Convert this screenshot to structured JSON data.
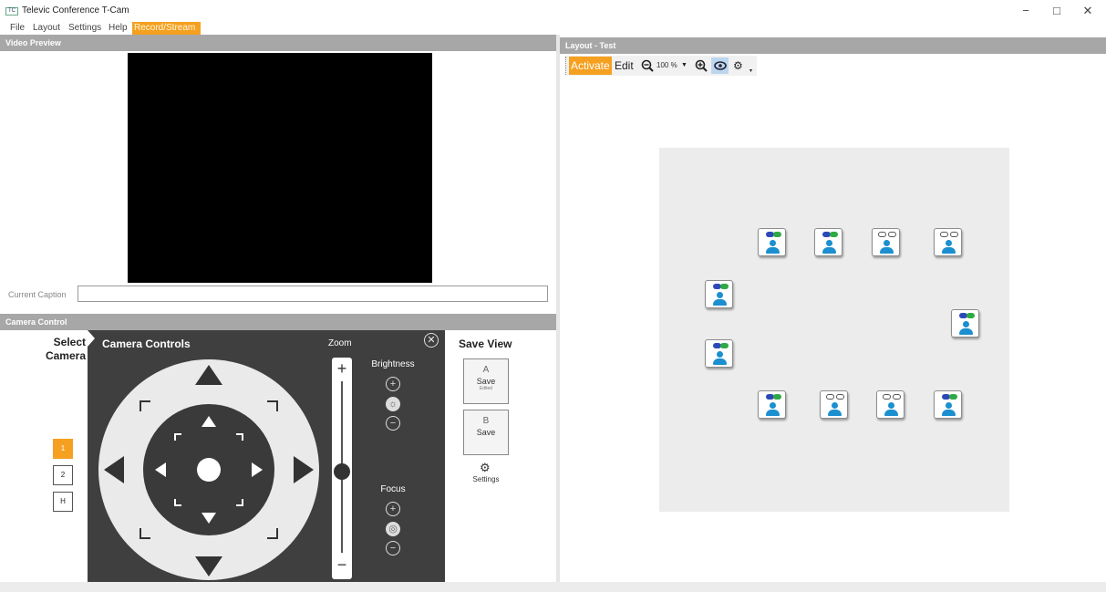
{
  "window": {
    "title": "Televic Conference T-Cam",
    "app_icon_text": "TC",
    "minimize": "−",
    "maximize": "□",
    "close": "✕"
  },
  "menu": {
    "items": [
      "File",
      "Layout",
      "Settings",
      "Help",
      "Record/Stream"
    ],
    "active": "Record/Stream"
  },
  "video_preview": {
    "header": "Video Preview",
    "caption_label": "Current Caption",
    "caption_value": ""
  },
  "camera_control": {
    "header": "Camera Control",
    "select_camera_title": "Select Camera",
    "cameras": [
      "1",
      "2",
      "H"
    ],
    "selected_camera": "1",
    "controls_title": "Camera Controls",
    "zoom_label": "Zoom",
    "zoom_level": 0.45,
    "brightness_label": "Brightness",
    "focus_label": "Focus",
    "plus_symbol": "+",
    "minus_symbol": "−",
    "close_symbol": "✕",
    "save_view_title": "Save View",
    "save_views": [
      {
        "letter": "A",
        "label": "Save",
        "sub": "Edited"
      },
      {
        "letter": "B",
        "label": "Save",
        "sub": ""
      }
    ],
    "settings_label": "Settings"
  },
  "layout": {
    "header": "Layout - Test",
    "toolbar": {
      "activate_label": "Activate",
      "edit_label": "Edit",
      "zoom_value": "100 %",
      "zoom_out_icon": "zoom-out-icon",
      "zoom_in_icon": "zoom-in-icon",
      "eye_icon": "eye-icon",
      "settings_icon": "gear-icon"
    },
    "seats": [
      {
        "badge": "active"
      },
      {
        "badge": "active"
      },
      {
        "badge": "idle"
      },
      {
        "badge": "idle"
      },
      {
        "badge": "active"
      },
      {
        "badge": "active"
      },
      {
        "badge": "active"
      },
      {
        "badge": "active"
      },
      {
        "badge": "idle"
      },
      {
        "badge": "idle"
      },
      {
        "badge": "active"
      }
    ],
    "colors": {
      "accent": "#f5a020",
      "seat_icon": "#1b8fd0",
      "badge_blue": "#2d49b8",
      "badge_green": "#2eaa44"
    }
  }
}
